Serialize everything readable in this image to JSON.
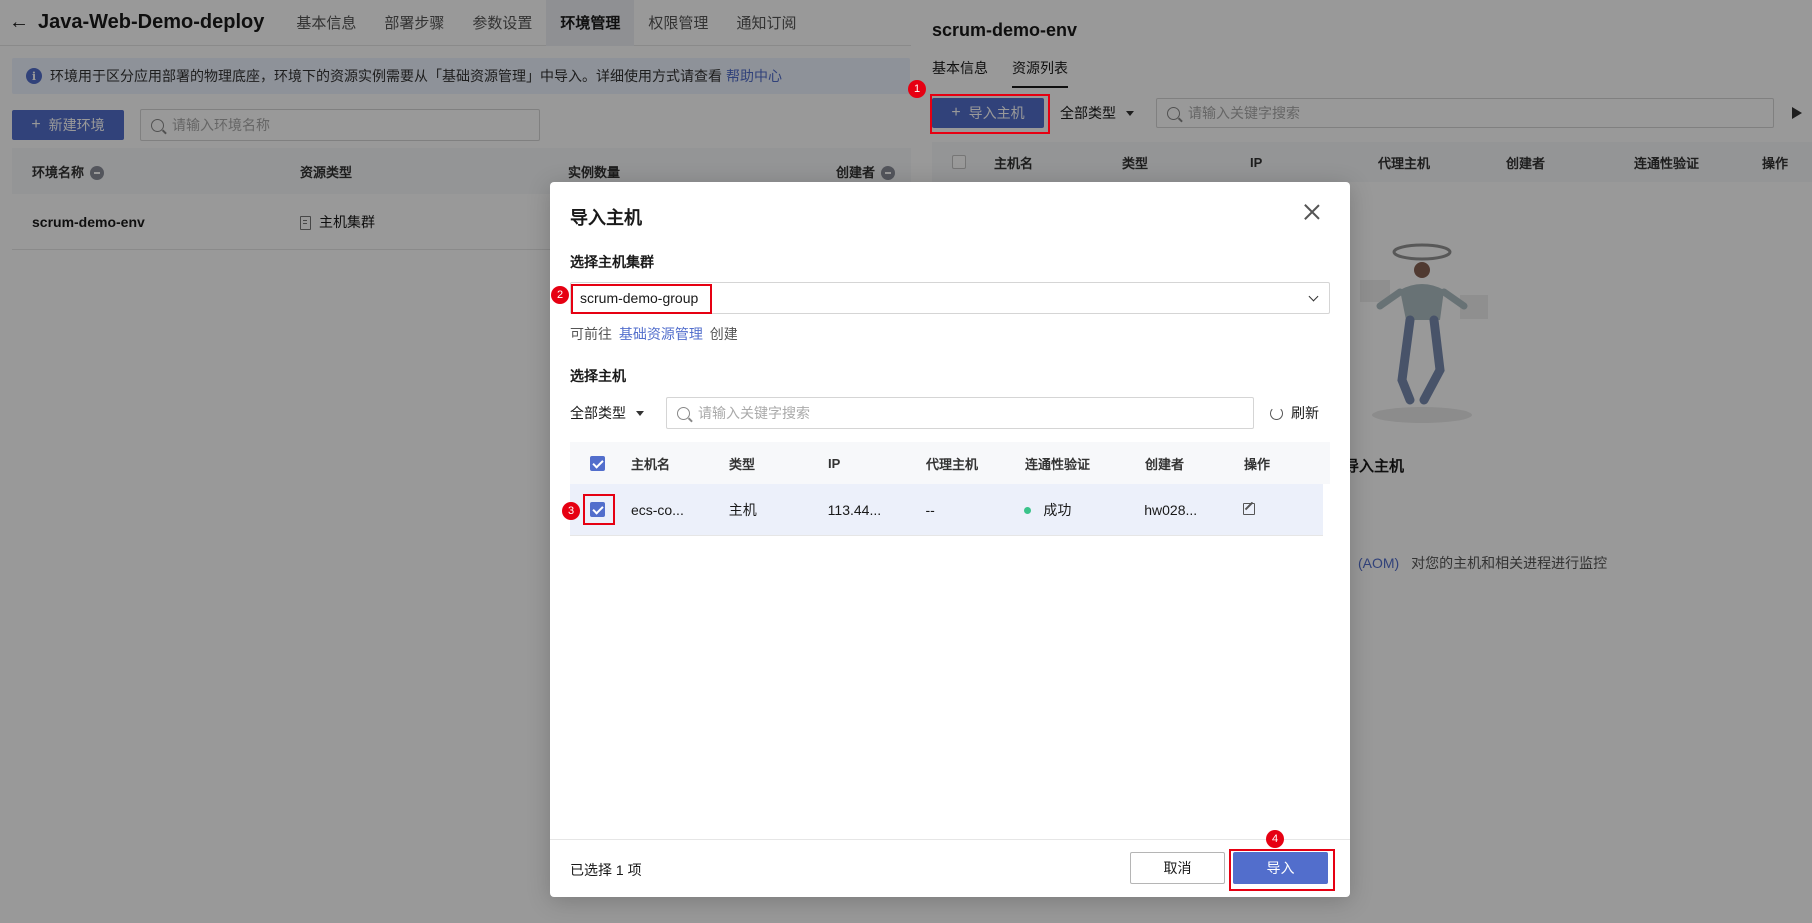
{
  "header": {
    "title": "Java-Web-Demo-deploy",
    "tabs": [
      {
        "label": "基本信息"
      },
      {
        "label": "部署步骤"
      },
      {
        "label": "参数设置"
      },
      {
        "label": "环境管理"
      },
      {
        "label": "权限管理"
      },
      {
        "label": "通知订阅"
      }
    ]
  },
  "banner": {
    "text": "环境用于区分应用部署的物理底座，环境下的资源实例需要从「基础资源管理」中导入。详细使用方式请查看",
    "link": "帮助中心"
  },
  "env_list": {
    "new_button": "新建环境",
    "search_placeholder": "请输入环境名称",
    "columns": [
      "环境名称",
      "资源类型",
      "实例数量",
      "创建者"
    ],
    "rows": [
      {
        "name": "scrum-demo-env",
        "type": "主机集群"
      }
    ]
  },
  "drawer": {
    "title": "scrum-demo-env",
    "tabs": [
      {
        "label": "基本信息"
      },
      {
        "label": "资源列表"
      }
    ],
    "import_button": "导入主机",
    "type_filter": "全部类型",
    "search_placeholder": "请输入关键字搜索",
    "columns": [
      "主机名",
      "类型",
      "IP",
      "代理主机",
      "创建者",
      "连通性验证",
      "操作"
    ],
    "empty_text": "当前环境下未导入主机",
    "empty_sub_aom": "(AOM)",
    "empty_sub_rest": "对您的主机和相关进程进行监控"
  },
  "modal": {
    "title": "导入主机",
    "cluster_label": "选择主机集群",
    "cluster_value": "scrum-demo-group",
    "hint_prefix": "可前往",
    "hint_link": "基础资源管理",
    "hint_suffix": "创建",
    "host_label": "选择主机",
    "type_filter": "全部类型",
    "search_placeholder": "请输入关键字搜索",
    "refresh": "刷新",
    "columns": [
      "主机名",
      "类型",
      "IP",
      "代理主机",
      "连通性验证",
      "创建者",
      "操作"
    ],
    "rows": [
      {
        "host": "ecs-co...",
        "type": "主机",
        "ip": "113.44...",
        "proxy": "--",
        "status": "成功",
        "creator": "hw028..."
      }
    ],
    "selected_count": "已选择 1 项",
    "cancel": "取消",
    "import": "导入"
  },
  "annotations": [
    "1",
    "2",
    "3",
    "4"
  ],
  "colors": {
    "primary": "#526ecc",
    "annotation": "#e60012",
    "success": "#3ac38a"
  }
}
